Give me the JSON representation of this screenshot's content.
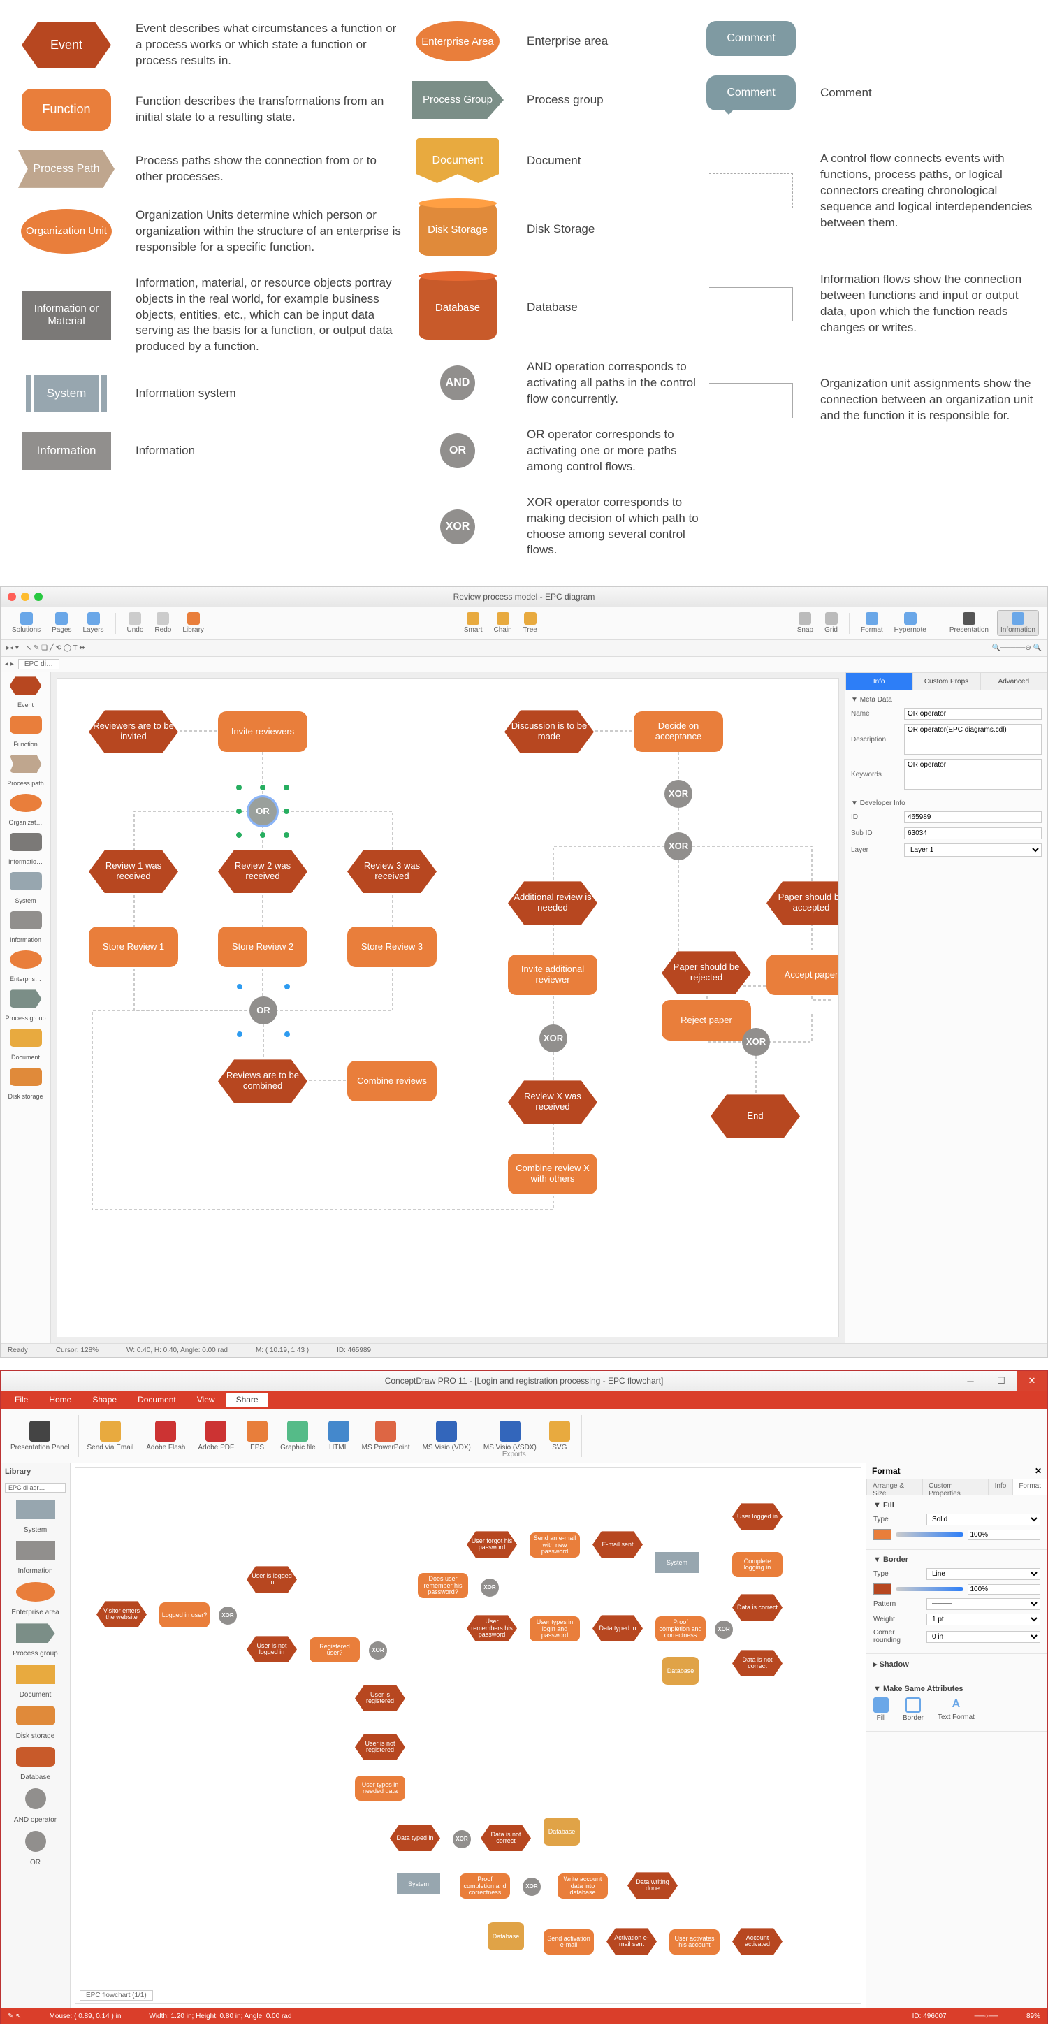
{
  "legend": {
    "col1": [
      {
        "label": "Event",
        "desc": "Event describes what circumstances a function or a process works or which state a function or process results in."
      },
      {
        "label": "Function",
        "desc": "Function describes the transformations from an initial state to a resulting state."
      },
      {
        "label": "Process Path",
        "desc": "Process paths show the connection from or to other processes."
      },
      {
        "label": "Organization Unit",
        "desc": "Organization Units determine which person or organization within the structure of an enterprise is responsible for a specific function."
      },
      {
        "label": "Information or Material",
        "desc": "Information, material, or resource objects portray objects in the real world, for example business objects, entities, etc., which can be input data serving as the basis for a function, or output data produced by a function."
      },
      {
        "label": "System",
        "desc": "Information system"
      },
      {
        "label": "Information",
        "desc": "Information"
      }
    ],
    "col2": [
      {
        "label": "Enterprise Area",
        "desc": "Enterprise area"
      },
      {
        "label": "Process Group",
        "desc": "Process group"
      },
      {
        "label": "Document",
        "desc": "Document"
      },
      {
        "label": "Disk Storage",
        "desc": "Disk Storage"
      },
      {
        "label": "Database",
        "desc": "Database"
      },
      {
        "label": "AND",
        "desc": "AND operation corresponds to activating all paths in the control flow concurrently."
      },
      {
        "label": "OR",
        "desc": "OR operator corresponds to activating one or more paths among control flows."
      },
      {
        "label": "XOR",
        "desc": "XOR operator corresponds to making decision of which path to choose among several control flows."
      }
    ],
    "col3": [
      {
        "label": "Comment",
        "desc": ""
      },
      {
        "label": "Comment",
        "desc": "Comment"
      },
      {
        "desc": "A control flow connects events with functions, process paths, or logical connectors creating chronological sequence and logical interdependencies between them."
      },
      {
        "desc": "Information flows show the connection between functions and input or output data, upon which the function reads changes or writes."
      },
      {
        "desc": "Organization unit assignments show the connection between an organization unit and the function it is responsible for."
      }
    ]
  },
  "macapp": {
    "title": "Review process model - EPC diagram",
    "toolbar": [
      "Solutions",
      "Pages",
      "Layers",
      "",
      "Undo",
      "Redo",
      "Library",
      "",
      "",
      "Smart",
      "Chain",
      "Tree",
      "",
      "",
      "Snap",
      "Grid",
      "",
      "Format",
      "Hypernote",
      "",
      "",
      "Presentation",
      "Information"
    ],
    "lib_items": [
      "Event",
      "Function",
      "Process path",
      "Organizat…",
      "Informatio…",
      "System",
      "Information",
      "Enterpris…",
      "Process group",
      "Document",
      "Disk storage"
    ],
    "tab": "EPC di…",
    "rightpanel": {
      "tabs": [
        "Info",
        "Custom Props",
        "Advanced"
      ],
      "section1": "Meta Data",
      "name_label": "Name",
      "name_value": "OR operator",
      "desc_label": "Description",
      "desc_value": "OR operator(EPC diagrams.cdl)",
      "key_label": "Keywords",
      "key_value": "OR operator",
      "section2": "Developer Info",
      "id_label": "ID",
      "id_value": "465989",
      "subid_label": "Sub ID",
      "subid_value": "63034",
      "layer_label": "Layer",
      "layer_value": "Layer 1"
    },
    "nodes": {
      "reviewers_invite": "Reviewers are to be invited",
      "invite": "Invite reviewers",
      "r1": "Review 1 was received",
      "r2": "Review 2 was received",
      "r3": "Review 3 was received",
      "s1": "Store Review 1",
      "s2": "Store Review 2",
      "s3": "Store Review 3",
      "combine_evt": "Reviews are to be combined",
      "combine": "Combine reviews",
      "discuss": "Discussion is to be made",
      "decide": "Decide on acceptance",
      "additional": "Additional review is needed",
      "invite_add": "Invite additional reviewer",
      "rx": "Review X was received",
      "combine_x": "Combine review X with others",
      "reject_evt": "Paper should be rejected",
      "accept_evt": "Paper should be accepted",
      "reject": "Reject paper",
      "accept": "Accept paper",
      "end": "End",
      "or": "OR",
      "xor": "XOR"
    },
    "status": {
      "ready": "Ready",
      "cursor": "Cursor: 128%",
      "wh": "W: 0.40, H: 0.40, Angle: 0.00 rad",
      "m": "M: ( 10.19, 1.43 )",
      "id": "ID: 465989"
    }
  },
  "winapp": {
    "title": "ConceptDraw PRO 11 - [Login and registration processing - EPC flowchart]",
    "menubar": [
      "File",
      "Home",
      "Shape",
      "Document",
      "View",
      "Share"
    ],
    "ribbon": [
      "Presentation Panel",
      "Send via Email",
      "Adobe Flash",
      "Adobe PDF",
      "EPS",
      "Graphic file",
      "HTML",
      "MS PowerPoint",
      "MS Visio (VDX)",
      "MS Visio (VSDX)",
      "SVG"
    ],
    "ribbon_group": "Exports",
    "libhead": "Library",
    "libtab": "EPC di agr…",
    "lib_items": [
      "System",
      "Information",
      "Enterprise area",
      "Process group",
      "Document",
      "Disk storage",
      "Database",
      "AND operator",
      "OR"
    ],
    "panel": {
      "title": "Format",
      "tabs": [
        "Arrange & Size",
        "Custom Properties",
        "Info",
        "Format"
      ],
      "fill": "Fill",
      "fill_type": "Type",
      "fill_val": "Solid",
      "fill_op": "100%",
      "border": "Border",
      "b_type": "Type",
      "b_val": "Line",
      "b_op": "100%",
      "pattern": "Pattern",
      "weight": "Weight",
      "weight_v": "1 pt",
      "corner": "Corner rounding",
      "corner_v": "0 in",
      "shadow": "Shadow",
      "msa": "Make Same Attributes",
      "msa_items": [
        "Fill",
        "Border",
        "Text Format"
      ]
    },
    "nodes": {
      "visitor": "Visitor enters the website",
      "logged": "Logged in user?",
      "u_logged": "User is logged in",
      "u_not_logged": "User is not logged in",
      "reg": "Registered user?",
      "u_reg": "User is registered",
      "u_notreg": "User is not registered",
      "types": "User types in needed data",
      "remember": "Does user remember his password?",
      "forgot": "User forgot his password",
      "remembers": "User remembers his password",
      "typelogin": "User types in login and password",
      "datatyped": "Data typed in",
      "proof": "Proof completion and correctness",
      "send_email": "Send an e-mail with new password",
      "emailsent": "E-mail sent",
      "u_logged2": "User logged in",
      "complete_login": "Complete logging in",
      "d_correct": "Data is correct",
      "d_notcorrect": "Data is not correct",
      "data_typed2": "Data typed in",
      "data_notcorr2": "Data is not correct",
      "write": "Write account data into database",
      "writing_done": "Data writing done",
      "send_act": "Send activation e-mail",
      "act_sent": "Activation e-mail sent",
      "user_act": "User activates his account",
      "acct_act": "Account activated",
      "sys": "System",
      "db": "Database",
      "xor": "XOR"
    },
    "status": {
      "tab": "EPC flowchart (1/1)",
      "mouse": "Mouse: ( 0.89, 0.14 ) in",
      "wh": "Width: 1.20 in; Height: 0.80 in; Angle: 0.00 rad",
      "id": "ID: 496007",
      "zoom": "89%"
    }
  }
}
